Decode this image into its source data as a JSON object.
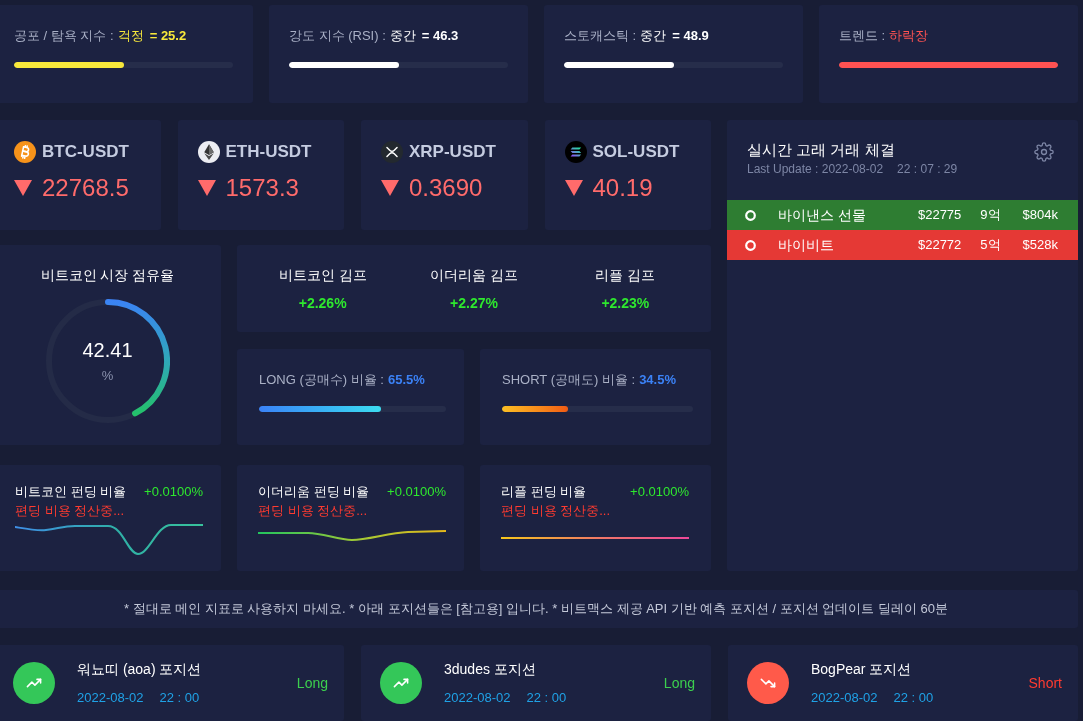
{
  "indicators": [
    {
      "label": "공포 / 탐욕 지수 :",
      "status": "걱정",
      "value": "= 25.2",
      "color": "#f8e83b",
      "level": 0.5
    },
    {
      "label": "강도 지수 (RSI) :",
      "status": "중간",
      "value": "= 46.3",
      "color": "#ffffff",
      "level": 0.5
    },
    {
      "label": "스토캐스틱 :",
      "status": "중간",
      "value": "= 48.9",
      "color": "#ffffff",
      "level": 0.5
    },
    {
      "label": "트렌드 :",
      "status": "하락장",
      "color": "#ff5252",
      "level": 1
    }
  ],
  "coins": [
    {
      "kind": "btc",
      "name": "BTC-USDT",
      "price": "22768.5",
      "falling": true
    },
    {
      "kind": "eth",
      "name": "ETH-USDT",
      "price": "1573.3",
      "falling": true
    },
    {
      "kind": "xrp",
      "name": "XRP-USDT",
      "price": "0.3690",
      "falling": true
    },
    {
      "kind": "sol",
      "name": "SOL-USDT",
      "price": "40.19",
      "falling": true
    }
  ],
  "whale_trades": {
    "title": "실시간 고래 거래 체결",
    "last_update": "Last Update : 2022-08-02",
    "time": "22 : 07 : 29",
    "rows": [
      {
        "exchange": "바이낸스 선물",
        "price": "$22775",
        "amount_krw": "9억",
        "amount_usd": "$804k",
        "color": "#2e7d32"
      },
      {
        "exchange": "바이비트",
        "price": "$22772",
        "amount_krw": "5억",
        "amount_usd": "$528k",
        "color": "#e53935"
      }
    ]
  },
  "dominance": {
    "title": "비트코인 시장 점유율",
    "value": "42.41",
    "unit": "%",
    "level": 0.4241
  },
  "kimchi_premium": [
    {
      "label": "비트코인 김프",
      "value": "+2.26%"
    },
    {
      "label": "이더리움 김프",
      "value": "+2.27%"
    },
    {
      "label": "리플 김프",
      "value": "+2.23%"
    }
  ],
  "long_short": [
    {
      "kind": "long",
      "label": "LONG (공매수) 비율 :",
      "value": "65.5%",
      "level": 0.655
    },
    {
      "kind": "short",
      "label": "SHORT (공매도) 비율 :",
      "value": "34.5%",
      "level": 0.345
    }
  ],
  "funding": [
    {
      "title": "비트코인 펀딩 비율",
      "value": "+0.0100%",
      "status": "편딩 비용 정산중..."
    },
    {
      "title": "이더리움 펀딩 비율",
      "value": "+0.0100%",
      "status": "편딩 비용 정산중..."
    },
    {
      "title": "리플 펀딩 비율",
      "value": "+0.0100%",
      "status": "편딩 비용 정산중..."
    }
  ],
  "notice": "* 절대로 메인 지표로 사용하지 마세요. * 아래 포지션들은 [참고용] 입니다. * 비트맥스 제공 API 기반 예측 포지션 / 포지션 업데이트 딜레이 60분",
  "positions": [
    {
      "kind": "long",
      "name": "워뇨띠 (aoa) 포지션",
      "date": "2022-08-02",
      "time": "22 : 00",
      "side": "Long"
    },
    {
      "kind": "long",
      "name": "3dudes 포지션",
      "date": "2022-08-02",
      "time": "22 : 00",
      "side": "Long"
    },
    {
      "kind": "short",
      "name": "BogPear 포지션",
      "date": "2022-08-02",
      "time": "22 : 00",
      "side": "Short"
    }
  ]
}
